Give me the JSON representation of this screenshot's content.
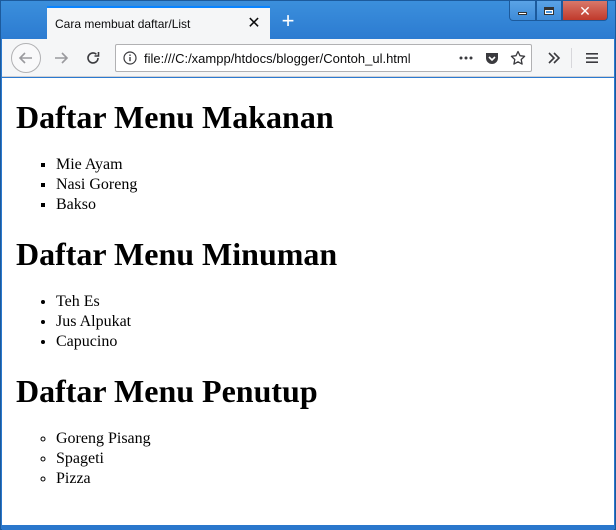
{
  "browser": {
    "tab_title": "Cara membuat daftar/List",
    "url": "file:///C:/xampp/htdocs/blogger/Contoh_ul.html"
  },
  "icons": {
    "tab_close": "close-icon",
    "new_tab": "plus-icon",
    "back": "arrow-left-icon",
    "forward": "arrow-right-icon",
    "reload": "reload-icon",
    "info": "info-icon",
    "page_actions": "more-horizontal-icon",
    "pocket": "pocket-icon",
    "bookmark": "star-icon",
    "overflow": "double-chevron-right-icon",
    "menu": "hamburger-menu-icon"
  },
  "colors": {
    "titlebar": "#2b7ad0",
    "tab_accent": "#0a84ff",
    "toolbar": "#f5f6f7",
    "close_button": "#c0392b"
  },
  "page": {
    "sections": [
      {
        "heading": "Daftar Menu Makanan",
        "bullet": "square",
        "items": [
          "Mie Ayam",
          "Nasi Goreng",
          "Bakso"
        ]
      },
      {
        "heading": "Daftar Menu Minuman",
        "bullet": "disc",
        "items": [
          "Teh Es",
          "Jus Alpukat",
          "Capucino"
        ]
      },
      {
        "heading": "Daftar Menu Penutup",
        "bullet": "circle",
        "items": [
          "Goreng Pisang",
          "Spageti",
          "Pizza"
        ]
      }
    ]
  }
}
